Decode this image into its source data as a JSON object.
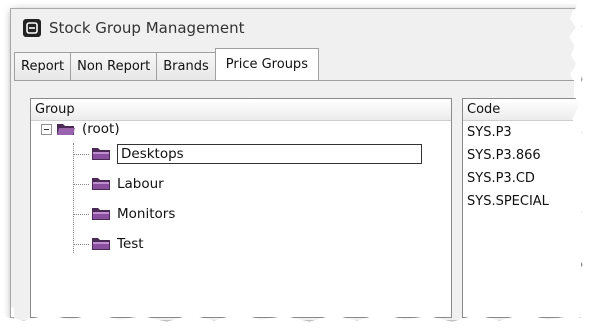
{
  "window": {
    "title": "Stock Group Management"
  },
  "tabs": [
    {
      "label": "Report",
      "active": false
    },
    {
      "label": "Non Report",
      "active": false
    },
    {
      "label": "Brands",
      "active": false
    },
    {
      "label": "Price Groups",
      "active": true
    }
  ],
  "group_panel": {
    "header": "Group",
    "root": {
      "label": "(root)",
      "expanded": true
    },
    "children": [
      {
        "label": "Desktops",
        "selected": true
      },
      {
        "label": "Labour",
        "selected": false
      },
      {
        "label": "Monitors",
        "selected": false
      },
      {
        "label": "Test",
        "selected": false
      }
    ]
  },
  "code_panel": {
    "header": "Code",
    "rows": [
      "SYS.P3",
      "SYS.P3.866",
      "SYS.P3.CD",
      "SYS.SPECIAL"
    ]
  },
  "colors": {
    "folder_fill": "#6b3b7a",
    "folder_highlight": "#b07cc0"
  },
  "icons": {
    "app": "app-logo-icon",
    "folder": "folder-icon",
    "expander": "collapse-minus-icon"
  }
}
